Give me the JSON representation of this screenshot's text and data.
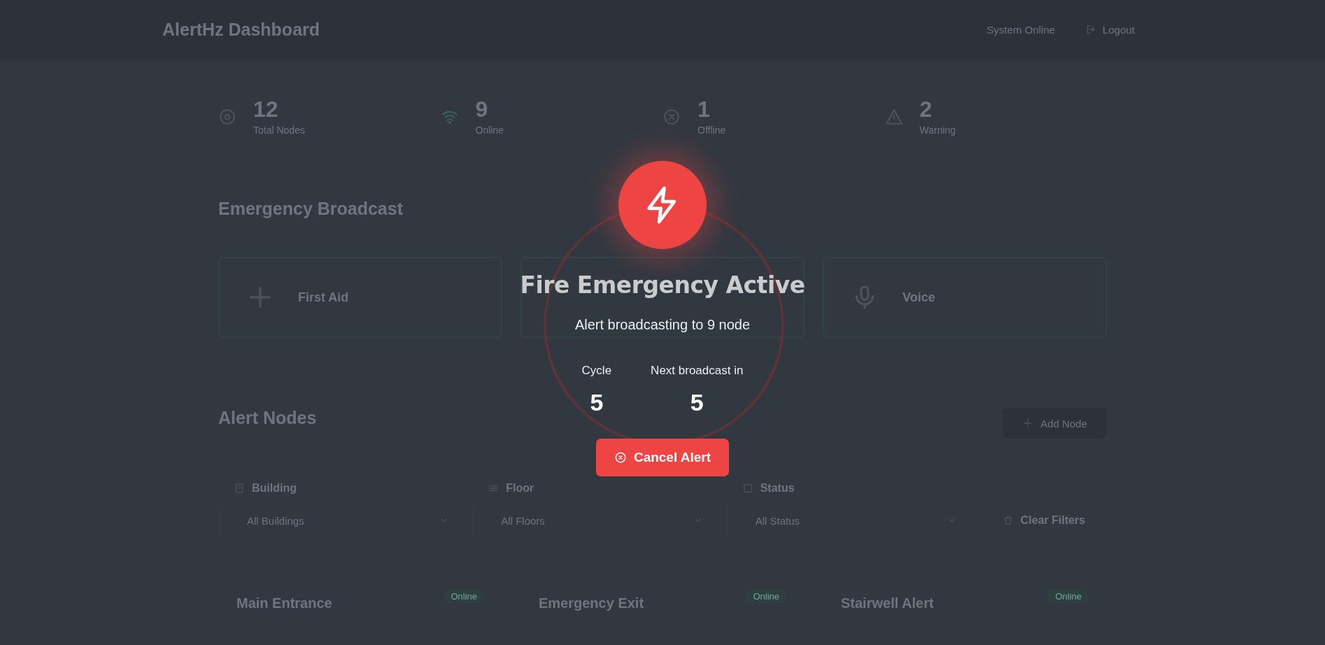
{
  "header": {
    "title": "AlertHz Dashboard",
    "status": "System Online",
    "logout": "Logout"
  },
  "stats": [
    {
      "kind": "total",
      "value": "12",
      "label": "Total Nodes"
    },
    {
      "kind": "online",
      "value": "9",
      "label": "Online"
    },
    {
      "kind": "offline",
      "value": "1",
      "label": "Offline"
    },
    {
      "kind": "warning",
      "value": "2",
      "label": "Warning"
    }
  ],
  "broadcast": {
    "title": "Emergency Broadcast",
    "types": [
      {
        "kind": "aid",
        "name": "First Aid"
      },
      {
        "kind": "fire"
      },
      {
        "kind": "voice",
        "name": "Voice"
      }
    ]
  },
  "nodes": {
    "title": "Alert Nodes",
    "add_button": "Add Node",
    "filters": [
      {
        "kind": "building",
        "label": "Building",
        "value": "All Buildings"
      },
      {
        "kind": "floor",
        "label": "Floor",
        "value": "All Floors"
      },
      {
        "kind": "status",
        "label": "Status",
        "value": "All Status"
      }
    ],
    "clear_button": "Clear Filters",
    "cards": [
      {
        "name": "Main Entrance",
        "status": "Online"
      },
      {
        "name": "Emergency Exit",
        "status": "Online"
      },
      {
        "name": "Stairwell Alert",
        "status": "Online"
      }
    ]
  },
  "modal": {
    "title": "Fire Emergency Active",
    "message": "Alert broadcasting to 9 node",
    "cycle_label": "Cycle",
    "cycle": "5",
    "next_label": "Next broadcast in",
    "next": "5",
    "cancel": "Cancel Alert"
  }
}
